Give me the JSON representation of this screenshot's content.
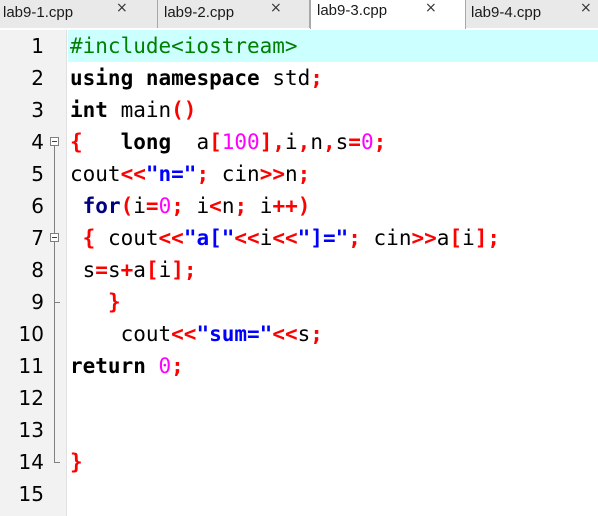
{
  "tabs": [
    {
      "label": "lab9-1.cpp",
      "close": "×",
      "active": false
    },
    {
      "label": "lab9-2.cpp",
      "close": "×",
      "active": false
    },
    {
      "label": "lab9-3.cpp",
      "close": "×",
      "active": true
    },
    {
      "label": "lab9-4.cpp",
      "close": "×",
      "active": false
    }
  ],
  "editor": {
    "line_numbers": [
      "1",
      "2",
      "3",
      "4",
      "5",
      "6",
      "7",
      "8",
      "9",
      "10",
      "11",
      "12",
      "13",
      "14",
      "15"
    ],
    "current_line": 1,
    "lines": [
      [
        {
          "t": "pre",
          "v": "#include<iostream>"
        }
      ],
      [
        {
          "t": "kw2",
          "v": "using"
        },
        {
          "t": "id",
          "v": " "
        },
        {
          "t": "kw2",
          "v": "namespace"
        },
        {
          "t": "id",
          "v": " std"
        },
        {
          "t": "op",
          "v": ";"
        }
      ],
      [
        {
          "t": "kw2",
          "v": "int"
        },
        {
          "t": "id",
          "v": " main"
        },
        {
          "t": "op",
          "v": "()"
        }
      ],
      [
        {
          "t": "op",
          "v": "{"
        },
        {
          "t": "id",
          "v": "   "
        },
        {
          "t": "kw2",
          "v": "long"
        },
        {
          "t": "id",
          "v": "  a"
        },
        {
          "t": "op",
          "v": "["
        },
        {
          "t": "num",
          "v": "100"
        },
        {
          "t": "op",
          "v": "],"
        },
        {
          "t": "id",
          "v": "i"
        },
        {
          "t": "op",
          "v": ","
        },
        {
          "t": "id",
          "v": "n"
        },
        {
          "t": "op",
          "v": ","
        },
        {
          "t": "id",
          "v": "s"
        },
        {
          "t": "op",
          "v": "="
        },
        {
          "t": "num",
          "v": "0"
        },
        {
          "t": "op",
          "v": ";"
        }
      ],
      [
        {
          "t": "id",
          "v": "cout"
        },
        {
          "t": "op",
          "v": "<<"
        },
        {
          "t": "str",
          "v": "\"n=\""
        },
        {
          "t": "op",
          "v": ";"
        },
        {
          "t": "id",
          "v": " cin"
        },
        {
          "t": "op",
          "v": ">>"
        },
        {
          "t": "id",
          "v": "n"
        },
        {
          "t": "op",
          "v": ";"
        }
      ],
      [
        {
          "t": "id",
          "v": " "
        },
        {
          "t": "kw",
          "v": "for"
        },
        {
          "t": "op",
          "v": "("
        },
        {
          "t": "id",
          "v": "i"
        },
        {
          "t": "op",
          "v": "="
        },
        {
          "t": "num",
          "v": "0"
        },
        {
          "t": "op",
          "v": ";"
        },
        {
          "t": "id",
          "v": " i"
        },
        {
          "t": "op",
          "v": "<"
        },
        {
          "t": "id",
          "v": "n"
        },
        {
          "t": "op",
          "v": ";"
        },
        {
          "t": "id",
          "v": " i"
        },
        {
          "t": "op",
          "v": "++)"
        }
      ],
      [
        {
          "t": "id",
          "v": " "
        },
        {
          "t": "op",
          "v": "{"
        },
        {
          "t": "id",
          "v": " cout"
        },
        {
          "t": "op",
          "v": "<<"
        },
        {
          "t": "str",
          "v": "\"a[\""
        },
        {
          "t": "op",
          "v": "<<"
        },
        {
          "t": "id",
          "v": "i"
        },
        {
          "t": "op",
          "v": "<<"
        },
        {
          "t": "str",
          "v": "\"]=\""
        },
        {
          "t": "op",
          "v": ";"
        },
        {
          "t": "id",
          "v": " cin"
        },
        {
          "t": "op",
          "v": ">>"
        },
        {
          "t": "id",
          "v": "a"
        },
        {
          "t": "op",
          "v": "["
        },
        {
          "t": "id",
          "v": "i"
        },
        {
          "t": "op",
          "v": "];"
        }
      ],
      [
        {
          "t": "id",
          "v": " s"
        },
        {
          "t": "op",
          "v": "="
        },
        {
          "t": "id",
          "v": "s"
        },
        {
          "t": "op",
          "v": "+"
        },
        {
          "t": "id",
          "v": "a"
        },
        {
          "t": "op",
          "v": "["
        },
        {
          "t": "id",
          "v": "i"
        },
        {
          "t": "op",
          "v": "];"
        }
      ],
      [
        {
          "t": "id",
          "v": "   "
        },
        {
          "t": "op",
          "v": "}"
        }
      ],
      [
        {
          "t": "id",
          "v": "    cout"
        },
        {
          "t": "op",
          "v": "<<"
        },
        {
          "t": "str",
          "v": "\"sum=\""
        },
        {
          "t": "op",
          "v": "<<"
        },
        {
          "t": "id",
          "v": "s"
        },
        {
          "t": "op",
          "v": ";"
        }
      ],
      [
        {
          "t": "kw2",
          "v": "return"
        },
        {
          "t": "id",
          "v": " "
        },
        {
          "t": "num",
          "v": "0"
        },
        {
          "t": "op",
          "v": ";"
        }
      ],
      [],
      [],
      [
        {
          "t": "op",
          "v": "}"
        }
      ],
      []
    ]
  }
}
